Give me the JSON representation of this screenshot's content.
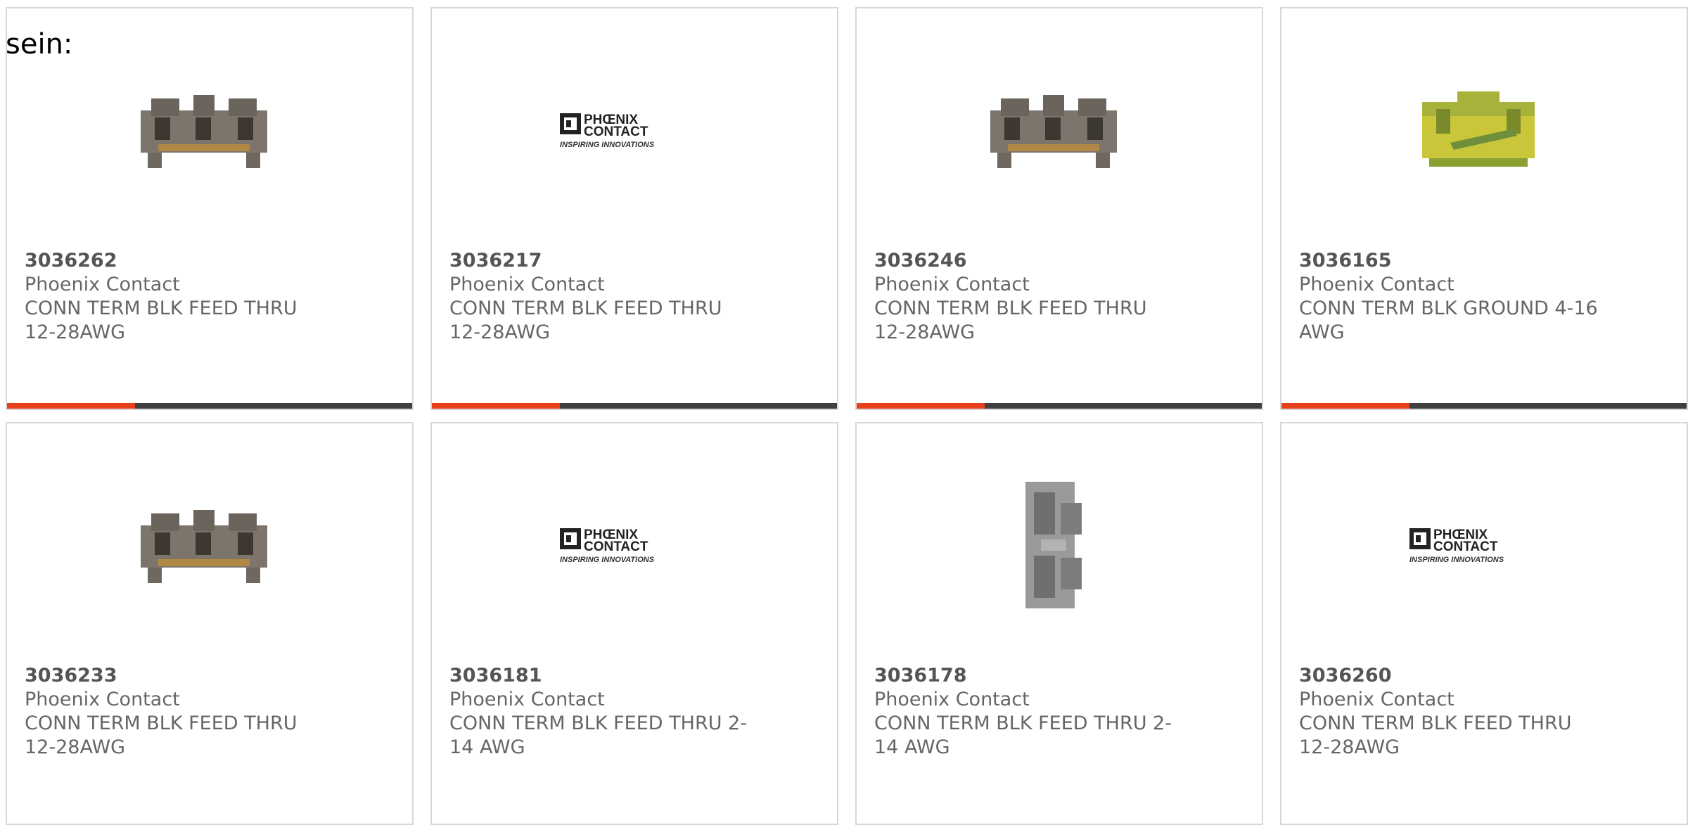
{
  "lead_text": "sein:",
  "accent_color": "#e8401c",
  "bar_color": "#3f3f3f",
  "logo": {
    "line1": "PHŒNIX",
    "line2": "CONTACT",
    "tagline": "INSPIRING INNOVATIONS"
  },
  "products": [
    {
      "part_number": "3036262",
      "manufacturer": "Phoenix Contact",
      "description": "CONN TERM BLK FEED THRU 12-28AWG",
      "image": "terminal-block-gray"
    },
    {
      "part_number": "3036217",
      "manufacturer": "Phoenix Contact",
      "description": "CONN TERM BLK FEED THRU 12-28AWG",
      "image": "phoenix-contact-logo"
    },
    {
      "part_number": "3036246",
      "manufacturer": "Phoenix Contact",
      "description": "CONN TERM BLK FEED THRU 12-28AWG",
      "image": "terminal-block-gray"
    },
    {
      "part_number": "3036165",
      "manufacturer": "Phoenix Contact",
      "description": "CONN TERM BLK GROUND 4-16 AWG",
      "image": "terminal-block-green-yellow"
    },
    {
      "part_number": "3036233",
      "manufacturer": "Phoenix Contact",
      "description": "CONN TERM BLK FEED THRU 12-28AWG",
      "image": "terminal-block-gray"
    },
    {
      "part_number": "3036181",
      "manufacturer": "Phoenix Contact",
      "description": "CONN TERM BLK FEED THRU 2-14 AWG",
      "image": "phoenix-contact-logo"
    },
    {
      "part_number": "3036178",
      "manufacturer": "Phoenix Contact",
      "description": "CONN TERM BLK FEED THRU 2-14 AWG",
      "image": "terminal-block-vertical"
    },
    {
      "part_number": "3036260",
      "manufacturer": "Phoenix Contact",
      "description": "CONN TERM BLK FEED THRU 12-28AWG",
      "image": "phoenix-contact-logo"
    }
  ]
}
